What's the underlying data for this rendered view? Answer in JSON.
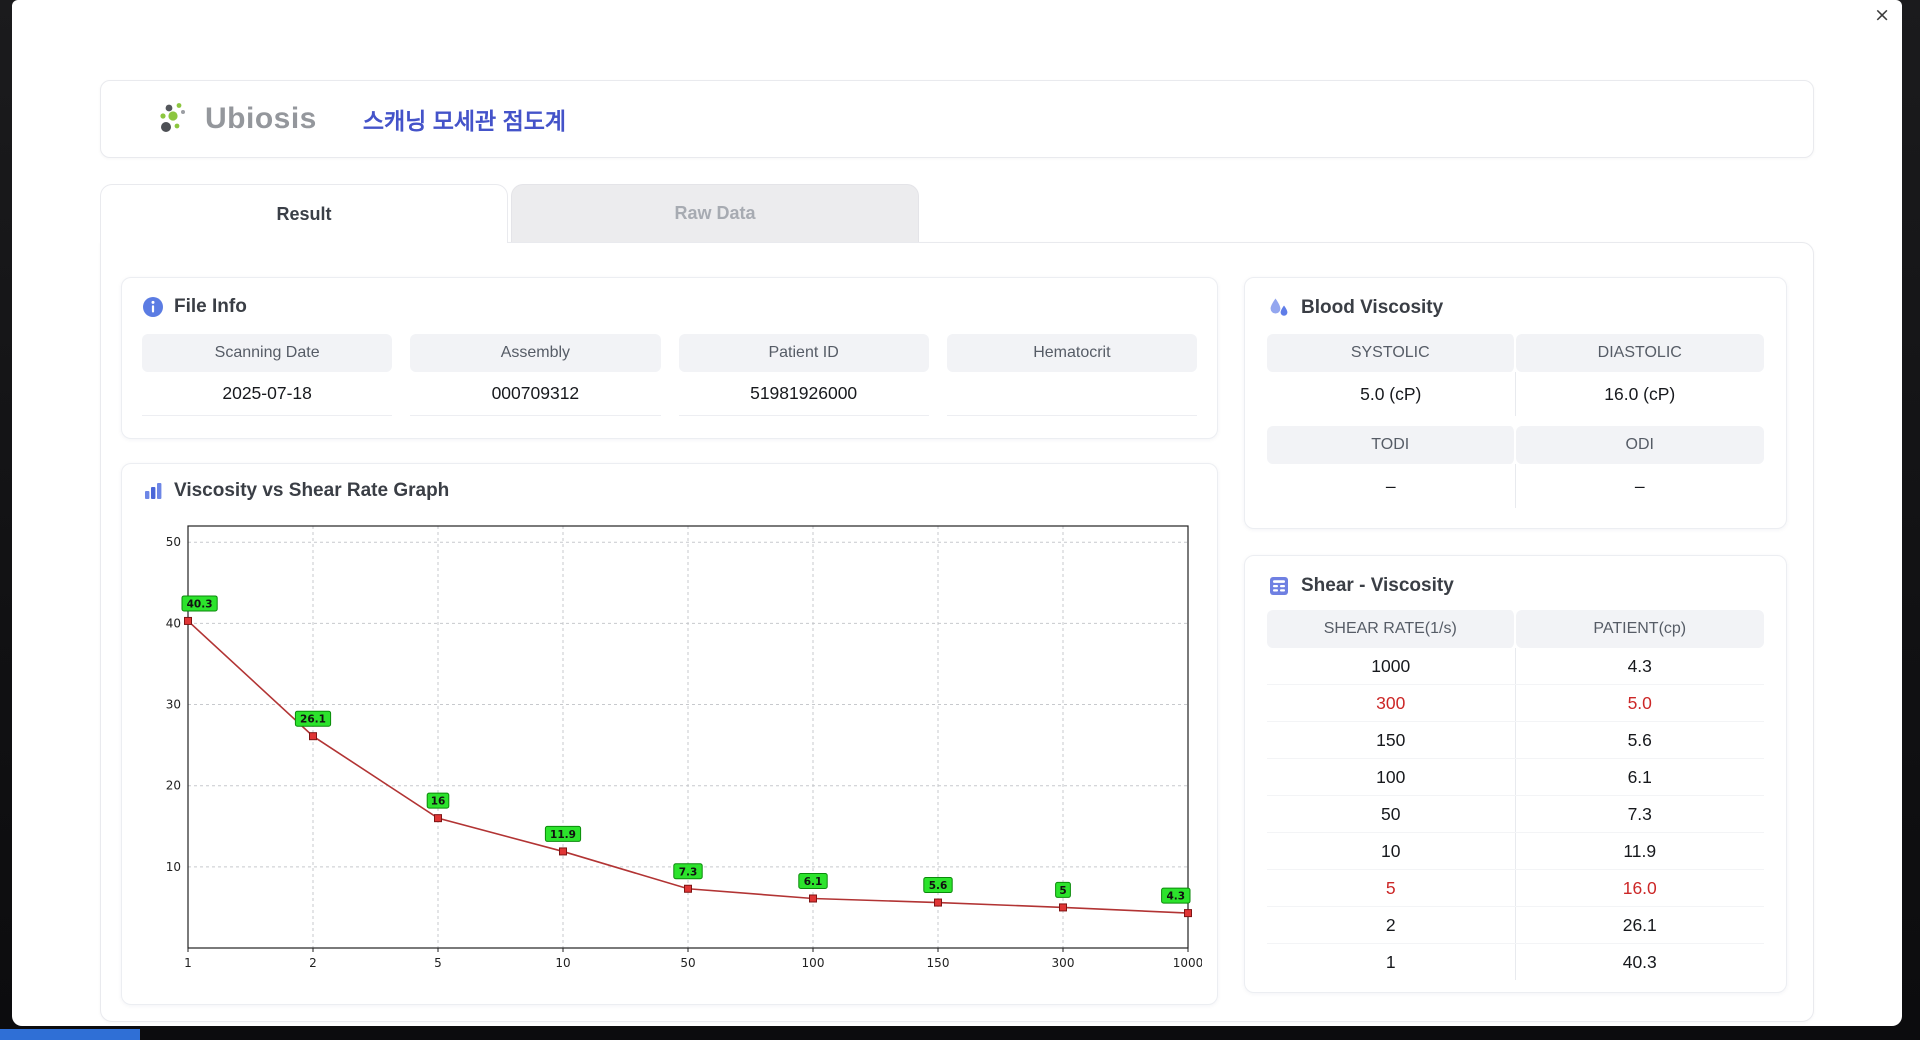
{
  "window": {
    "close_label": "×"
  },
  "header": {
    "logo_text": "Ubiosis",
    "title": "스캐닝 모세관 점도계"
  },
  "tabs": [
    {
      "label": "Result",
      "active": true
    },
    {
      "label": "Raw Data",
      "active": false
    }
  ],
  "file_info": {
    "title": "File Info",
    "fields": [
      {
        "label": "Scanning Date",
        "value": "2025-07-18"
      },
      {
        "label": "Assembly",
        "value": "000709312"
      },
      {
        "label": "Patient ID",
        "value": "51981926000"
      },
      {
        "label": "Hematocrit",
        "value": ""
      }
    ]
  },
  "graph": {
    "title": "Viscosity vs Shear Rate Graph"
  },
  "blood_viscosity": {
    "title": "Blood Viscosity",
    "rows": [
      {
        "labels": [
          "SYSTOLIC",
          "DIASTOLIC"
        ],
        "values": [
          "5.0 (cP)",
          "16.0 (cP)"
        ]
      },
      {
        "labels": [
          "TODI",
          "ODI"
        ],
        "values": [
          "–",
          "–"
        ]
      }
    ]
  },
  "shear_viscosity": {
    "title": "Shear - Viscosity",
    "columns": [
      "SHEAR RATE(1/s)",
      "PATIENT(cp)"
    ],
    "rows": [
      {
        "rate": "1000",
        "patient": "4.3",
        "highlight": false
      },
      {
        "rate": "300",
        "patient": "5.0",
        "highlight": true
      },
      {
        "rate": "150",
        "patient": "5.6",
        "highlight": false
      },
      {
        "rate": "100",
        "patient": "6.1",
        "highlight": false
      },
      {
        "rate": "50",
        "patient": "7.3",
        "highlight": false
      },
      {
        "rate": "10",
        "patient": "11.9",
        "highlight": false
      },
      {
        "rate": "5",
        "patient": "16.0",
        "highlight": true
      },
      {
        "rate": "2",
        "patient": "26.1",
        "highlight": false
      },
      {
        "rate": "1",
        "patient": "40.3",
        "highlight": false
      }
    ]
  },
  "colors": {
    "accent_blue": "#4453c9",
    "highlight_red": "#cc2727",
    "label_green": "#2ce32c",
    "line_red": "#b23434"
  },
  "chart_data": {
    "type": "line",
    "title": "Viscosity vs Shear Rate Graph",
    "x_scale": "categorical",
    "x_ticks": [
      1,
      2,
      5,
      10,
      50,
      100,
      150,
      300,
      1000
    ],
    "y": [
      40.3,
      26.1,
      16,
      11.9,
      7.3,
      6.1,
      5.6,
      5,
      4.3
    ],
    "point_labels": [
      "40.3",
      "26.1",
      "16",
      "11.9",
      "7.3",
      "6.1",
      "5.6",
      "5",
      "4.3"
    ],
    "ylim": [
      0,
      52
    ],
    "y_ticks": [
      10,
      20,
      30,
      40,
      50
    ],
    "grid": "dashed",
    "legend": false,
    "line_color": "#b23434",
    "marker_color": "#e03535",
    "label_bg": "#2ce32c"
  }
}
